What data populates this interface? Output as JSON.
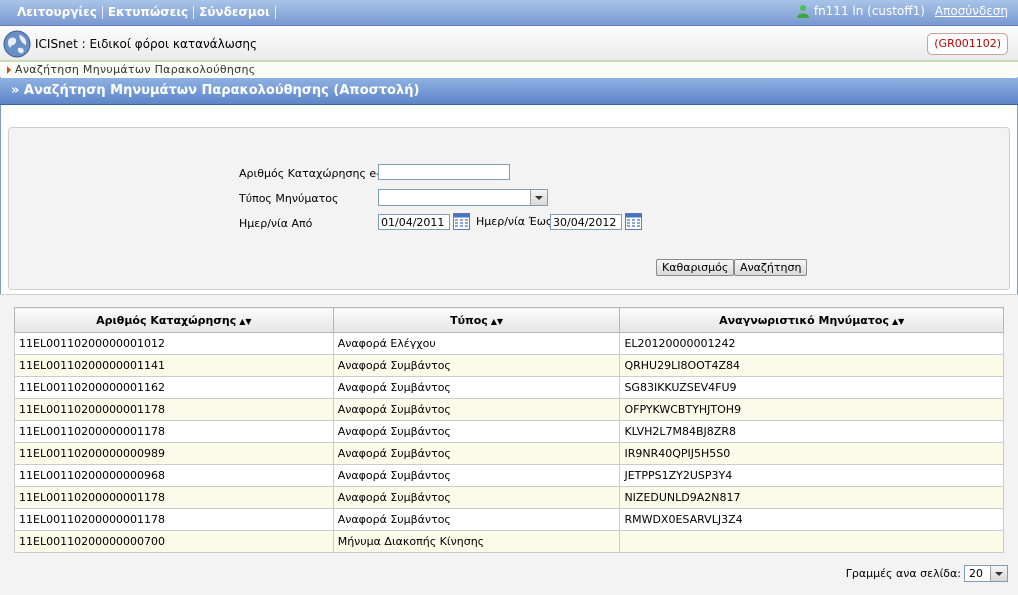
{
  "menu": {
    "items": [
      "Λειτουργίες",
      "Εκτυπώσεις",
      "Σύνδεσμοι"
    ],
    "user": "fn111 ln (custoff1)",
    "logout": "Αποσύνδεση"
  },
  "app": {
    "title": "ICISnet : Ειδικοί φόροι κατανάλωσης",
    "code": "(GR001102)"
  },
  "breadcrumb": "Αναζήτηση Μηνυμάτων Παρακολούθησης",
  "page_title": "» Αναζήτηση Μηνυμάτων Παρακολούθησης (Αποστολή)",
  "form": {
    "reg_label": "Αριθμός Καταχώρησης e-ΔΕ",
    "reg_value": "",
    "type_label": "Τύπος Μηνύματος",
    "type_value": "",
    "date_from_label": "Ημερ/νία Από",
    "date_from": "01/04/2011",
    "date_to_label": "Ημερ/νία Έως",
    "date_to": "30/04/2012",
    "clear_button": "Καθαρισμός",
    "search_button": "Αναζήτηση"
  },
  "table": {
    "headers": [
      "Αριθμός Καταχώρησης",
      "Τύπος",
      "Αναγνωριστικό Μηνύματος"
    ],
    "rows": [
      [
        "11EL00110200000001012",
        "Αναφορά Ελέγχου",
        "EL20120000001242"
      ],
      [
        "11EL00110200000001141",
        "Αναφορά Συμβάντος",
        "QRHU29LI8OOT4Z84"
      ],
      [
        "11EL00110200000001162",
        "Αναφορά Συμβάντος",
        "SG83IKKUZSEV4FU9"
      ],
      [
        "11EL00110200000001178",
        "Αναφορά Συμβάντος",
        "OFPYKWCBTYHJTOH9"
      ],
      [
        "11EL00110200000001178",
        "Αναφορά Συμβάντος",
        "KLVH2L7M84BJ8ZR8"
      ],
      [
        "11EL00110200000000989",
        "Αναφορά Συμβάντος",
        "IR9NR40QPIJ5H5S0"
      ],
      [
        "11EL00110200000000968",
        "Αναφορά Συμβάντος",
        "JETPPS1ZY2USP3Y4"
      ],
      [
        "11EL00110200000001178",
        "Αναφορά Συμβάντος",
        "NIZEDUNLD9A2N817"
      ],
      [
        "11EL00110200000001178",
        "Αναφορά Συμβάντος",
        "RMWDX0ESARVLJ3Z4"
      ],
      [
        "11EL00110200000000700",
        "Μήνυμα Διακοπής Κίνησης",
        ""
      ]
    ]
  },
  "pagination": {
    "rows_per_page_label": "Γραμμές ανα σελίδα:",
    "rows_per_page": "20"
  }
}
